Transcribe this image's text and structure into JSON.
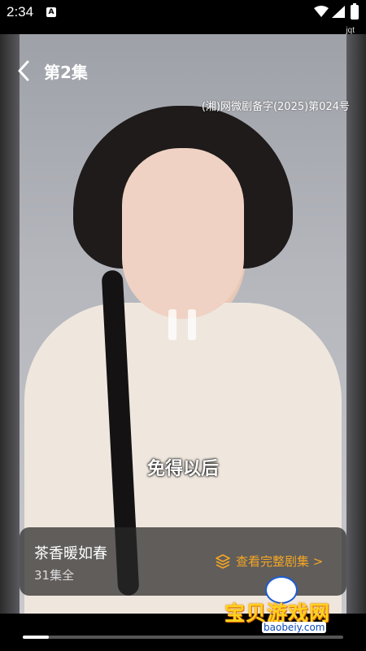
{
  "status_bar": {
    "time": "2:34",
    "notification_icon": "A",
    "extra_label": "jqt"
  },
  "header": {
    "back_icon": "chevron-left-icon",
    "episode_title": "第2集"
  },
  "video": {
    "license_text": "(湘)网微剧备字(2025)第024号",
    "subtitle": "免得以后",
    "playback_state": "paused",
    "progress": 0.08
  },
  "series_card": {
    "name": "茶香暖如春",
    "episode_count": "31集全",
    "full_series_link": "查看完整剧集 >",
    "accent_color": "#f5a623"
  },
  "watermark": {
    "text": "宝贝游戏网",
    "url": "baobeiy.com"
  }
}
